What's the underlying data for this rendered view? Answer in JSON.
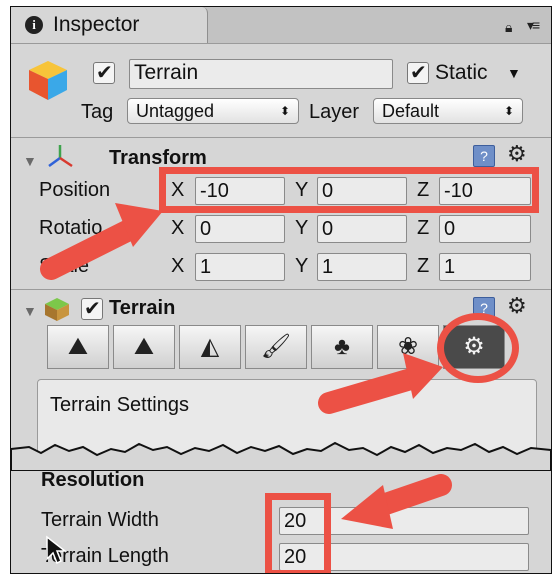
{
  "tab": {
    "title": "Inspector",
    "icon": "info-icon"
  },
  "object": {
    "name": "Terrain",
    "active": true,
    "static_label": "Static",
    "static": true,
    "tag_label": "Tag",
    "tag_value": "Untagged",
    "layer_label": "Layer",
    "layer_value": "Default"
  },
  "transform": {
    "title": "Transform",
    "position": {
      "label": "Position",
      "x": "-10",
      "y": "0",
      "z": "-10"
    },
    "rotation": {
      "label": "Rotatio",
      "x": "0",
      "y": "0",
      "z": "0"
    },
    "scale": {
      "label": "Scale",
      "x": "1",
      "y": "1",
      "z": "1"
    },
    "axis_labels": {
      "x": "X",
      "y": "Y",
      "z": "Z"
    }
  },
  "terrain": {
    "title": "Terrain",
    "enabled": true,
    "tools": [
      {
        "icon": "raise-lower-terrain-icon"
      },
      {
        "icon": "paint-height-icon"
      },
      {
        "icon": "smooth-height-icon"
      },
      {
        "icon": "paint-texture-icon"
      },
      {
        "icon": "place-trees-icon"
      },
      {
        "icon": "paint-details-icon"
      },
      {
        "icon": "terrain-settings-icon",
        "active": true
      }
    ],
    "settings_title": "Terrain Settings",
    "resolution_title": "Resolution",
    "width_label": "Terrain Width",
    "width_value": "20",
    "length_label": "Terrain Length",
    "length_value": "20"
  },
  "colors": {
    "highlight": "#ec5145",
    "panel": "#d6d6d6",
    "active_tool": "#4a4a4a"
  }
}
